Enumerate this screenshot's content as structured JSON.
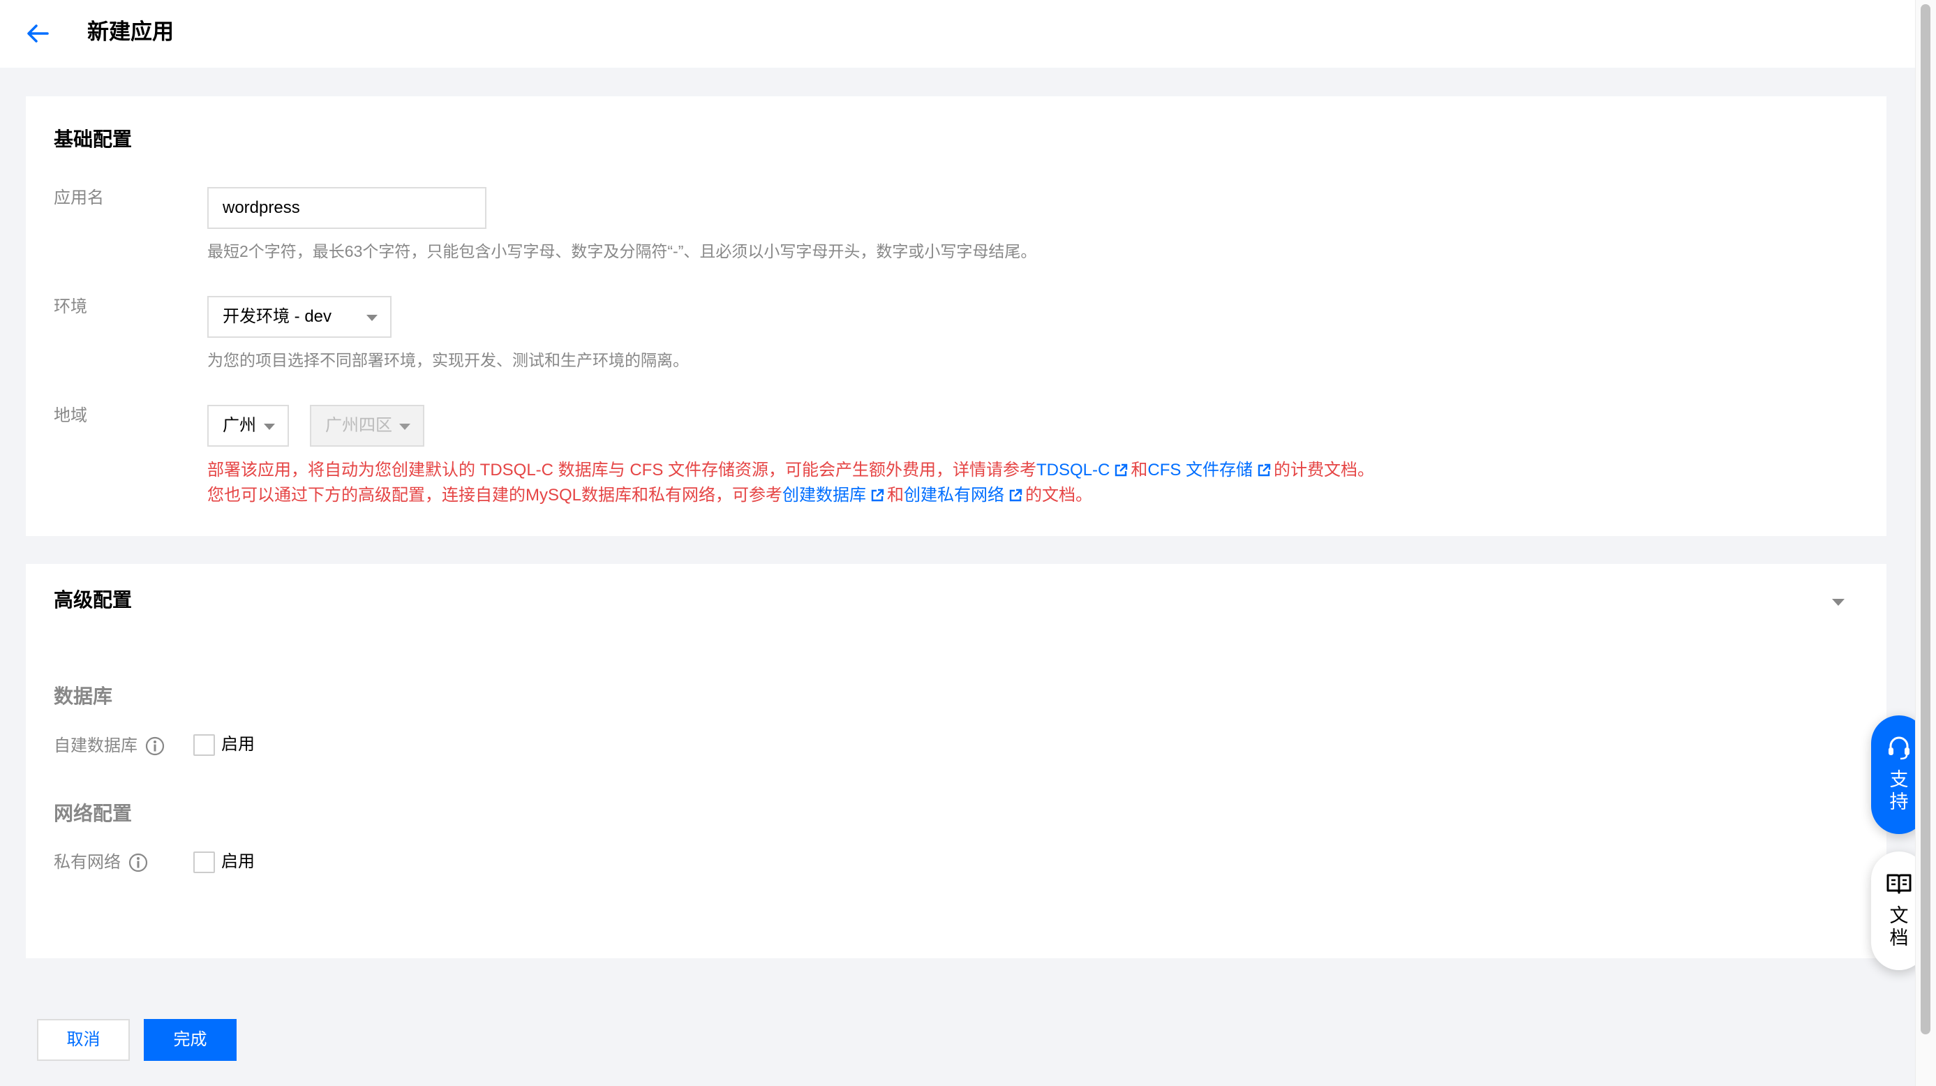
{
  "header": {
    "title": "新建应用"
  },
  "basic": {
    "title": "基础配置",
    "app_name": {
      "label": "应用名",
      "value": "wordpress",
      "help": "最短2个字符，最长63个字符，只能包含小写字母、数字及分隔符“-”、且必须以小写字母开头，数字或小写字母结尾。"
    },
    "env": {
      "label": "环境",
      "selected": "开发环境 - dev",
      "help": "为您的项目选择不同部署环境，实现开发、测试和生产环境的隔离。"
    },
    "region": {
      "label": "地域",
      "selected": "广州",
      "zone": "广州四区"
    },
    "notice": {
      "line1_a": "部署该应用，将自动为您创建默认的 TDSQL-C 数据库与 CFS 文件存储资源，可能会产生额外费用，详情请参考",
      "link_tdsql": "TDSQL-C",
      "line1_b": "和",
      "link_cfs": "CFS 文件存储",
      "line1_c": "的计费文档。",
      "line2_a": "您也可以通过下方的高级配置，连接自建的MySQL数据库和私有网络，可参考",
      "link_create_db": "创建数据库",
      "line2_b": "和",
      "link_create_vpc": "创建私有网络",
      "line2_c": "的文档。"
    }
  },
  "advanced": {
    "title": "高级配置",
    "database": {
      "title": "数据库",
      "label": "自建数据库",
      "option": "启用"
    },
    "network": {
      "title": "网络配置",
      "label": "私有网络",
      "option": "启用"
    }
  },
  "footer": {
    "cancel": "取消",
    "done": "完成"
  },
  "floating": {
    "support": "支\n持",
    "docs": "文\n档"
  },
  "colors": {
    "primary": "#006eff",
    "danger": "#e54545",
    "muted": "#888888"
  }
}
